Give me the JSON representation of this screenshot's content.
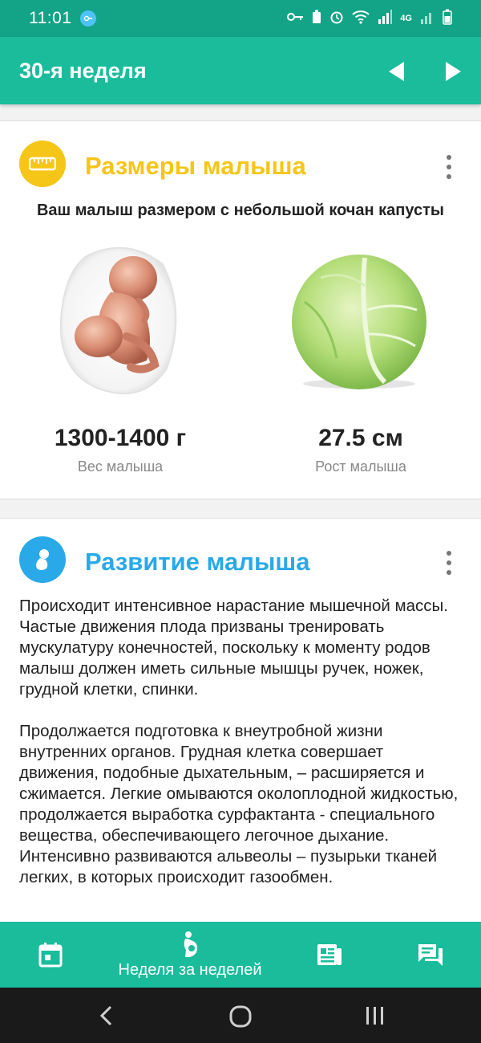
{
  "status_bar": {
    "time": "11:01",
    "network": "4G"
  },
  "app_bar": {
    "title": "30-я неделя",
    "prev_icon": "triangle-left-icon",
    "next_icon": "triangle-right-icon"
  },
  "size_card": {
    "title": "Размеры малыша",
    "title_color": "#f5c518",
    "icon": "measuring-tape-icon",
    "caption": "Ваш малыш размером с небольшой кочан капусты",
    "weight_value": "1300-1400 г",
    "weight_label": "Вес малыша",
    "height_value": "27.5 см",
    "height_label": "Рост малыша"
  },
  "development_card": {
    "title": "Развитие малыша",
    "title_color": "#29a9e8",
    "icon": "fetus-icon",
    "text": "Происходит интенсивное нарастание мышечной массы. Частые движения плода призваны тренировать мускулатуру конечностей, поскольку к моменту родов малыш должен иметь сильные мышцы ручек, ножек, грудной клетки, спинки.\n\nПродолжается подготовка к внеутробной жизни внутренних органов. Грудная клетка совершает движения, подобные дыхательным, – расширяется и сжимается. Легкие омываются околоплодной жидкостью, продолжается выработка сурфактанта - специального вещества, обеспечивающего легочное дыхание. Интенсивно развиваются альвеолы – пузырьки тканей легких, в которых происходит газообмен."
  },
  "bottom_nav": {
    "tabs": [
      {
        "icon": "calendar-icon",
        "label": ""
      },
      {
        "icon": "pregnancy-icon",
        "label": "Неделя за неделей"
      },
      {
        "icon": "articles-icon",
        "label": ""
      },
      {
        "icon": "chat-icon",
        "label": ""
      }
    ]
  },
  "colors": {
    "primary": "#1abc9c",
    "status_bar": "#13a386",
    "yellow_accent": "#f5c518",
    "blue_accent": "#29a9e8"
  }
}
